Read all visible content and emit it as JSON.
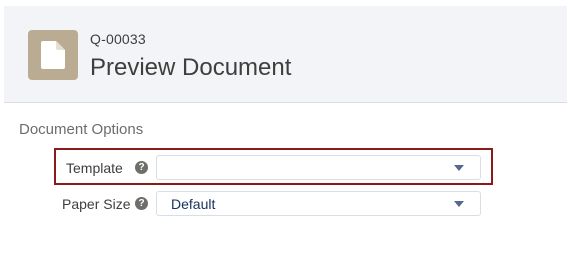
{
  "header": {
    "record_id": "Q-00033",
    "title": "Preview Document",
    "icon": "document-icon"
  },
  "section": {
    "title": "Document Options"
  },
  "fields": {
    "template": {
      "label": "Template",
      "value": "",
      "help_icon": "help-icon"
    },
    "paper_size": {
      "label": "Paper Size",
      "value": "Default",
      "help_icon": "help-icon"
    }
  },
  "colors": {
    "header_bg": "#f3f4f7",
    "icon_tile": "#baac93",
    "highlight_border": "#8b1a1a"
  }
}
